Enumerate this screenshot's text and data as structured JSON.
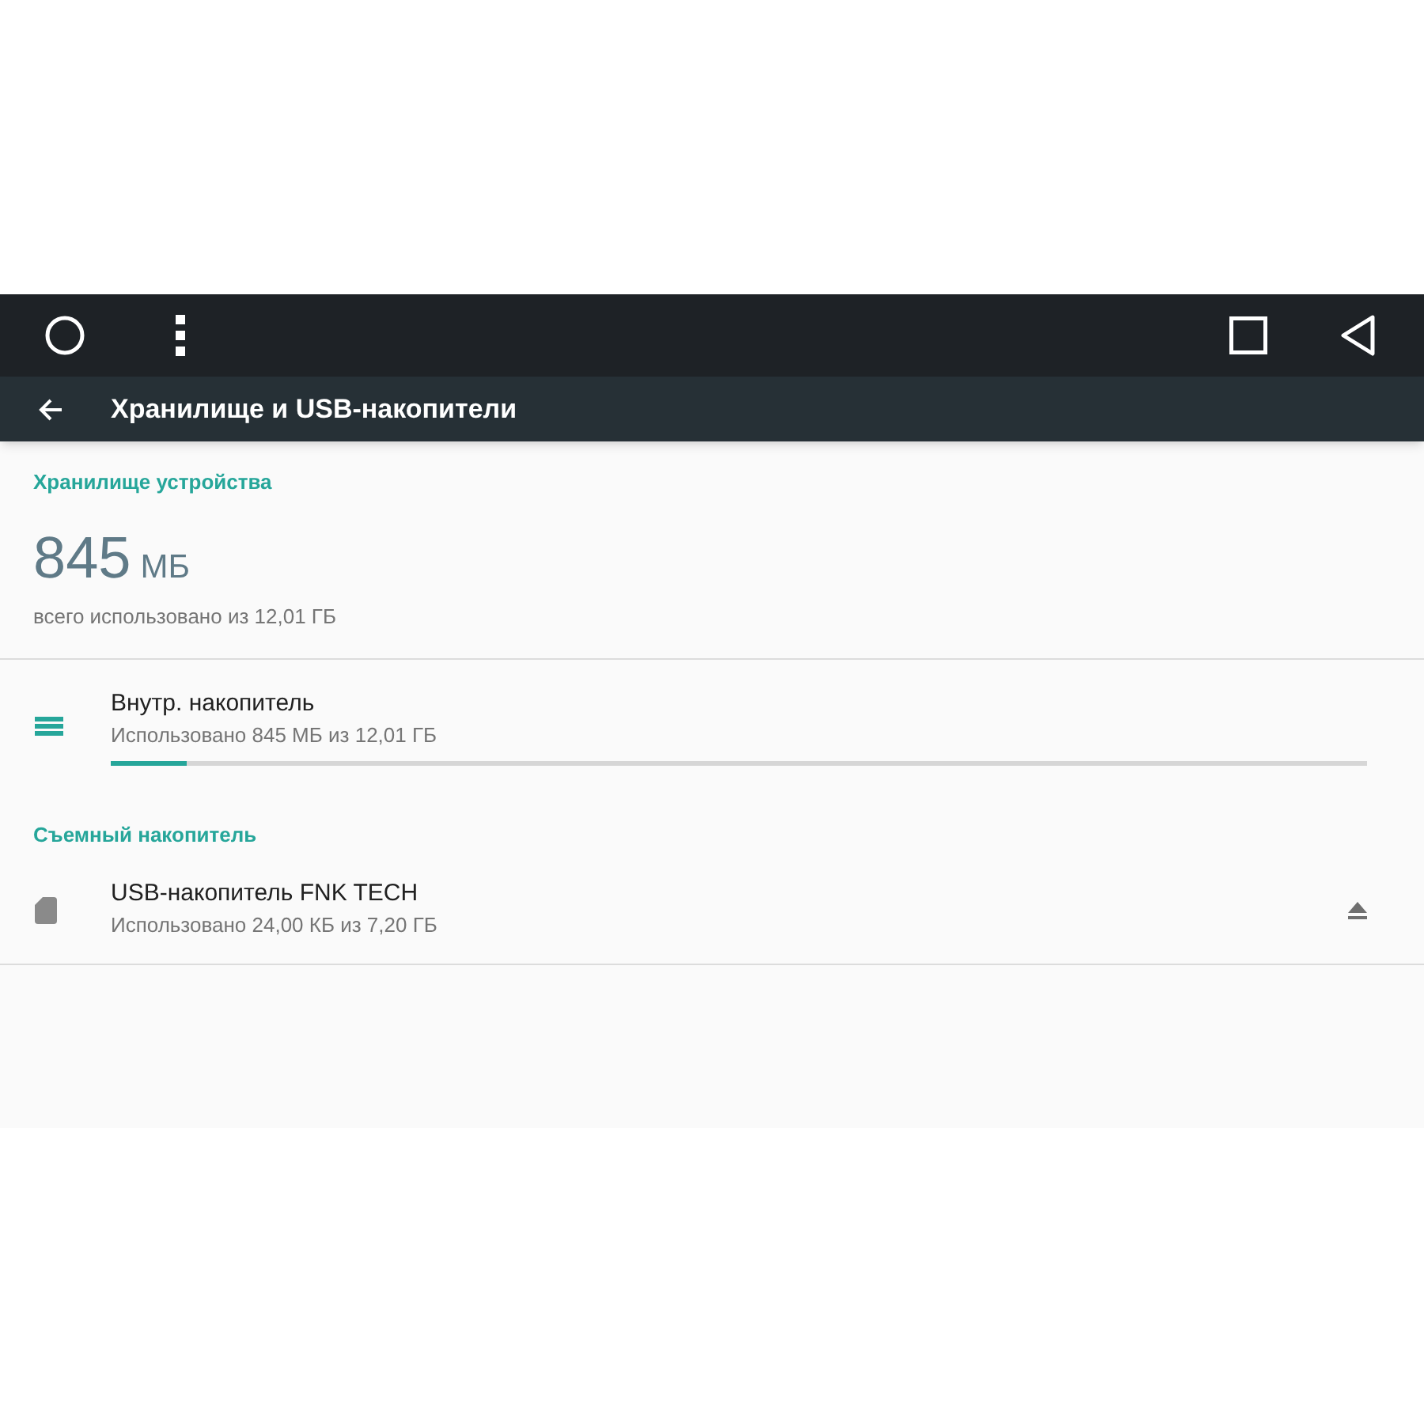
{
  "toolbar": {
    "title": "Хранилище и USB-накопители"
  },
  "device_storage": {
    "header": "Хранилище устройства",
    "used_value": "845",
    "used_unit": "МБ",
    "used_caption": "всего использовано из 12,01 ГБ",
    "items": [
      {
        "kind": "internal",
        "title": "Внутр. накопитель",
        "summary": "Использовано 845 МБ из 12,01 ГБ",
        "level": 0.06
      }
    ]
  },
  "removable_storage": {
    "header": "Съемный накопитель",
    "items": [
      {
        "kind": "sdcard",
        "title": "USB-накопитель FNK TECH",
        "summary": "Использовано 24,00 КБ из 7,20 ГБ",
        "ejectable": true
      }
    ]
  }
}
